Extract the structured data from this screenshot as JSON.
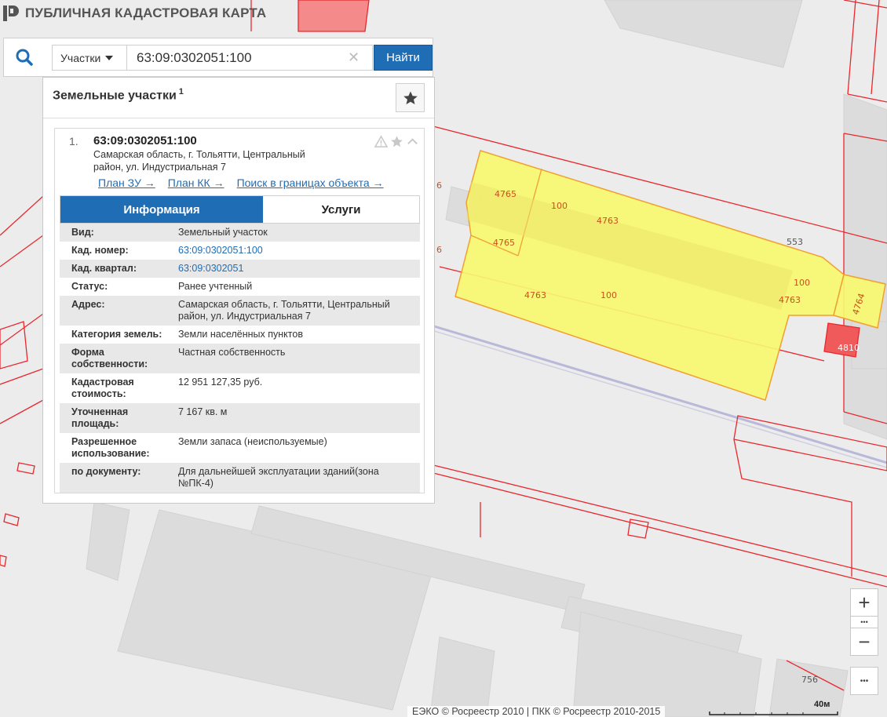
{
  "app": {
    "title": "ПУБЛИЧНАЯ КАДАСТРОВАЯ КАРТА"
  },
  "search": {
    "type": "Участки",
    "value": "63:09:0302051:100",
    "button": "Найти"
  },
  "panel": {
    "title": "Земельные участки",
    "count": "1",
    "result": {
      "index": "1.",
      "number": "63:09:0302051:100",
      "address": "Самарская область, г. Тольятти, Центральный район, ул. Индустриальная 7",
      "links": [
        "План ЗУ →",
        "План КК →",
        "Поиск в границах объекта →"
      ],
      "tabs": {
        "info": "Информация",
        "services": "Услуги"
      },
      "rows": [
        {
          "label": "Вид:",
          "value": "Земельный участок"
        },
        {
          "label": "Кад. номер:",
          "value": "63:09:0302051:100"
        },
        {
          "label": "Кад. квартал:",
          "value": "63:09:0302051"
        },
        {
          "label": "Статус:",
          "value": "Ранее учтенный"
        },
        {
          "label": "Адрес:",
          "value": "Самарская область, г. Тольятти, Центральный район, ул. Индустриальная 7"
        },
        {
          "label": "Категория земель:",
          "value": "Земли населённых пунктов"
        },
        {
          "label": "Форма собственности:",
          "value": "Частная собственность"
        },
        {
          "label": "Кадастровая стоимость:",
          "value": "12 951 127,35 руб."
        },
        {
          "label": "Уточненная площадь:",
          "value": "7 167 кв. м"
        },
        {
          "label": "Разрешенное использование:",
          "value": "Земли запаса (неиспользуемые)"
        },
        {
          "label": "по документу:",
          "value": "Для дальнейшей эксплуатации зданий(зона №ПК-4)"
        }
      ]
    }
  },
  "map": {
    "labels": {
      "l4765a": "4765",
      "l4765b": "4765",
      "l100a": "100",
      "l4763a": "4763",
      "l553": "553",
      "l100b": "100",
      "l4763b": "4763",
      "l100c": "100",
      "l4763c": "4763",
      "l4764": "4764",
      "l4810": "4810",
      "l756": "756",
      "l6a": "6",
      "l6b": "6"
    }
  },
  "controls": {
    "zoom_in": "+",
    "zoom_out": "−",
    "more": "•••"
  },
  "attribution": "ЕЭКО © Росреестр 2010 | ПКК © Росреестр 2010-2015",
  "scale": "40м",
  "colors": {
    "parcel_fill": "#f7f76f",
    "parcel_stroke": "#f0a030",
    "boundary": "#e8282e",
    "highlight": "#f58a8a",
    "accent": "#1f6db5"
  }
}
